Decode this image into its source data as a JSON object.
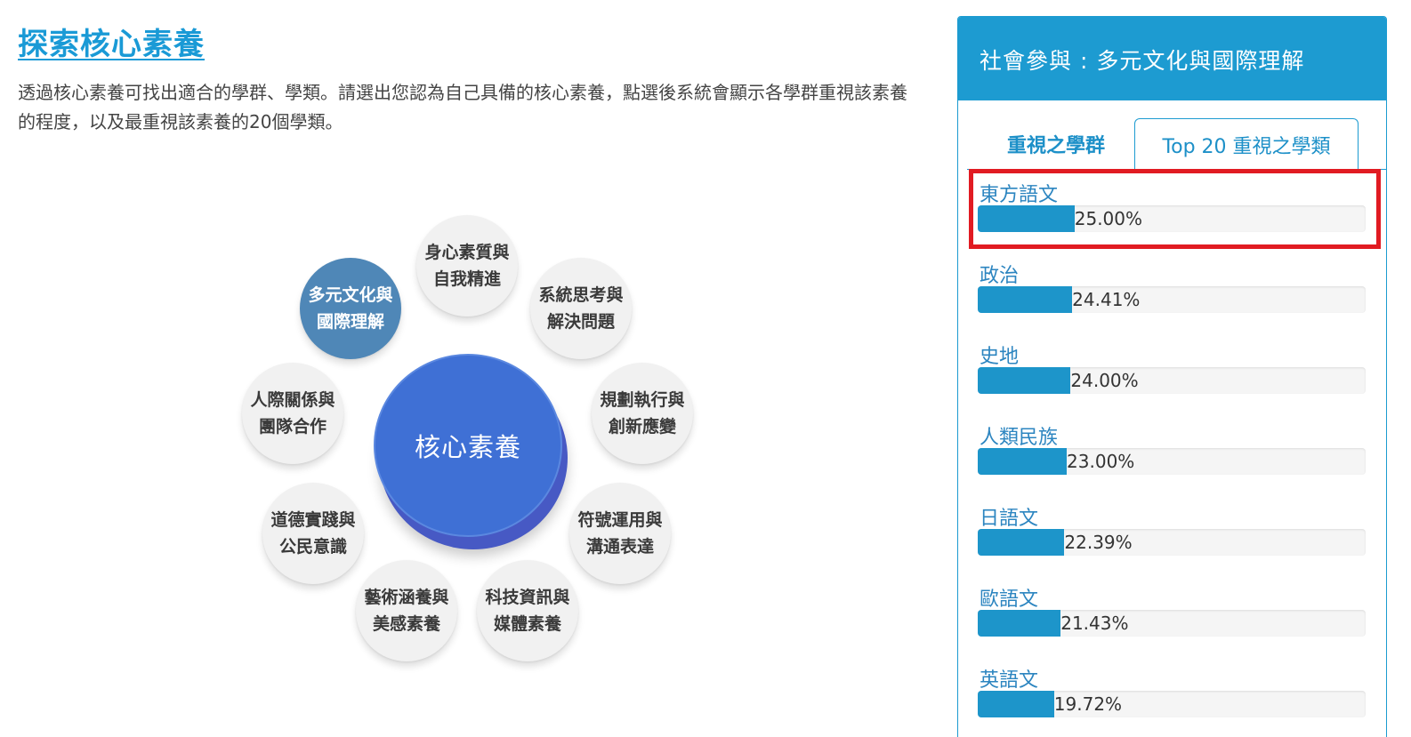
{
  "page": {
    "title": "探索核心素養",
    "intro": "透過核心素養可找出適合的學群、學類。請選出您認為自己具備的核心素養，點選後系統會顯示各學群重視該素養的程度，以及最重視該素養的20個學類。"
  },
  "diagram": {
    "center": "核心素養",
    "nodes": [
      {
        "id": "multicultural",
        "line1": "多元文化與",
        "line2": "國際理解",
        "active": true
      },
      {
        "id": "wellbeing",
        "line1": "身心素質與",
        "line2": "自我精進",
        "active": false
      },
      {
        "id": "systems",
        "line1": "系統思考與",
        "line2": "解決問題",
        "active": false
      },
      {
        "id": "planning",
        "line1": "規劃執行與",
        "line2": "創新應變",
        "active": false
      },
      {
        "id": "symbols",
        "line1": "符號運用與",
        "line2": "溝通表達",
        "active": false
      },
      {
        "id": "technology",
        "line1": "科技資訊與",
        "line2": "媒體素養",
        "active": false
      },
      {
        "id": "arts",
        "line1": "藝術涵養與",
        "line2": "美感素養",
        "active": false
      },
      {
        "id": "ethics",
        "line1": "道德實踐與",
        "line2": "公民意識",
        "active": false
      },
      {
        "id": "interpersonal",
        "line1": "人際關係與",
        "line2": "團隊合作",
        "active": false
      }
    ]
  },
  "panel": {
    "header": "社會參與 : 多元文化與國際理解",
    "tabs": [
      {
        "label": "重視之學群",
        "active": false
      },
      {
        "label": "Top 20 重視之學類",
        "active": true
      }
    ],
    "items": [
      {
        "name": "東方語文",
        "percent": 25.0,
        "label": "25.00%"
      },
      {
        "name": "政治",
        "percent": 24.41,
        "label": "24.41%"
      },
      {
        "name": "史地",
        "percent": 24.0,
        "label": "24.00%"
      },
      {
        "name": "人類民族",
        "percent": 23.0,
        "label": "23.00%"
      },
      {
        "name": "日語文",
        "percent": 22.39,
        "label": "22.39%"
      },
      {
        "name": "歐語文",
        "percent": 21.43,
        "label": "21.43%"
      },
      {
        "name": "英語文",
        "percent": 19.72,
        "label": "19.72%"
      }
    ]
  },
  "colors": {
    "accent": "#1d9bd1",
    "active_node": "#4f87b7",
    "core": "#3f70d5",
    "highlight": "#e11b22"
  }
}
